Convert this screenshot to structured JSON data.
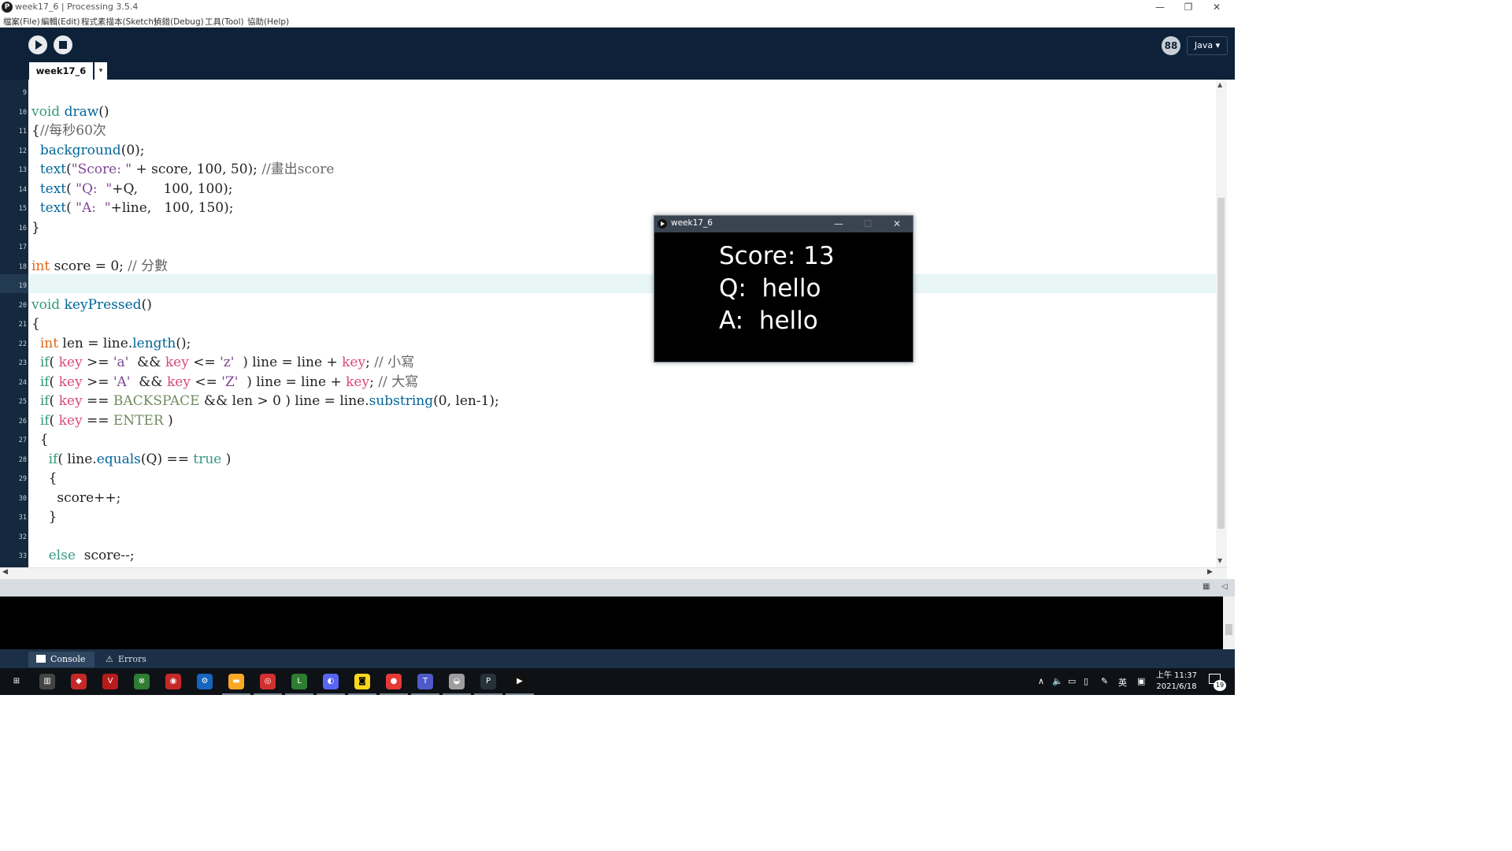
{
  "window": {
    "title": "week17_6 | Processing 3.5.4",
    "app_logo": "P"
  },
  "menu": [
    "檔案(File)",
    "編輯(Edit)",
    "程式素描本(Sketch)",
    "偵錯(Debug)",
    "工具(Tool)",
    "協助(Help)"
  ],
  "toolbar": {
    "mode_label": "Java ▾",
    "mode_icon_glyph": "88",
    "tab_label": "week17_6",
    "tab_menu": "▾"
  },
  "editor": {
    "current_line": 19,
    "lines": [
      {
        "n": "9",
        "tokens": []
      },
      {
        "n": "10",
        "tokens": [
          {
            "t": "void",
            "c": "v"
          },
          {
            "t": " "
          },
          {
            "t": "draw",
            "c": "f"
          },
          {
            "t": "()"
          }
        ]
      },
      {
        "n": "11",
        "tokens": [
          {
            "t": "{"
          },
          {
            "t": "//每秒60次",
            "c": "c"
          }
        ]
      },
      {
        "n": "12",
        "tokens": [
          {
            "t": "  "
          },
          {
            "t": "background",
            "c": "f"
          },
          {
            "t": "(0);"
          }
        ]
      },
      {
        "n": "13",
        "tokens": [
          {
            "t": "  "
          },
          {
            "t": "text",
            "c": "f"
          },
          {
            "t": "("
          },
          {
            "t": "\"Score: \"",
            "c": "s"
          },
          {
            "t": " + score, 100, 50); "
          },
          {
            "t": "//畫出score",
            "c": "c"
          }
        ]
      },
      {
        "n": "14",
        "tokens": [
          {
            "t": "  "
          },
          {
            "t": "text",
            "c": "f"
          },
          {
            "t": "( "
          },
          {
            "t": "\"Q:  \"",
            "c": "s"
          },
          {
            "t": "+Q,      100, 100);"
          }
        ]
      },
      {
        "n": "15",
        "tokens": [
          {
            "t": "  "
          },
          {
            "t": "text",
            "c": "f"
          },
          {
            "t": "( "
          },
          {
            "t": "\"A:  \"",
            "c": "s"
          },
          {
            "t": "+line,   100, 150);"
          }
        ]
      },
      {
        "n": "16",
        "tokens": [
          {
            "t": "}"
          }
        ]
      },
      {
        "n": "17",
        "tokens": []
      },
      {
        "n": "18",
        "tokens": [
          {
            "t": "int",
            "c": "k"
          },
          {
            "t": " score = 0; "
          },
          {
            "t": "// 分數",
            "c": "c"
          }
        ]
      },
      {
        "n": "19",
        "tokens": []
      },
      {
        "n": "20",
        "tokens": [
          {
            "t": "void",
            "c": "v"
          },
          {
            "t": " "
          },
          {
            "t": "keyPressed",
            "c": "f"
          },
          {
            "t": "()"
          }
        ]
      },
      {
        "n": "21",
        "tokens": [
          {
            "t": "{"
          }
        ]
      },
      {
        "n": "22",
        "tokens": [
          {
            "t": "  "
          },
          {
            "t": "int",
            "c": "k"
          },
          {
            "t": " len = line."
          },
          {
            "t": "length",
            "c": "f"
          },
          {
            "t": "();"
          }
        ]
      },
      {
        "n": "23",
        "tokens": [
          {
            "t": "  "
          },
          {
            "t": "if",
            "c": "v"
          },
          {
            "t": "( "
          },
          {
            "t": "key",
            "c": "p"
          },
          {
            "t": " >= "
          },
          {
            "t": "'a'",
            "c": "s"
          },
          {
            "t": "  && "
          },
          {
            "t": "key",
            "c": "p"
          },
          {
            "t": " <= "
          },
          {
            "t": "'z'",
            "c": "s"
          },
          {
            "t": "  ) line = line + "
          },
          {
            "t": "key",
            "c": "p"
          },
          {
            "t": "; "
          },
          {
            "t": "// 小寫",
            "c": "c"
          }
        ]
      },
      {
        "n": "24",
        "tokens": [
          {
            "t": "  "
          },
          {
            "t": "if",
            "c": "v"
          },
          {
            "t": "( "
          },
          {
            "t": "key",
            "c": "p"
          },
          {
            "t": " >= "
          },
          {
            "t": "'A'",
            "c": "s"
          },
          {
            "t": "  && "
          },
          {
            "t": "key",
            "c": "p"
          },
          {
            "t": " <= "
          },
          {
            "t": "'Z'",
            "c": "s"
          },
          {
            "t": "  ) line = line + "
          },
          {
            "t": "key",
            "c": "p"
          },
          {
            "t": "; "
          },
          {
            "t": "// 大寫",
            "c": "c"
          }
        ]
      },
      {
        "n": "25",
        "tokens": [
          {
            "t": "  "
          },
          {
            "t": "if",
            "c": "v"
          },
          {
            "t": "( "
          },
          {
            "t": "key",
            "c": "p"
          },
          {
            "t": " == "
          },
          {
            "t": "BACKSPACE",
            "c": "g"
          },
          {
            "t": " && len > 0 ) line = line."
          },
          {
            "t": "substring",
            "c": "f"
          },
          {
            "t": "(0, len-1);"
          }
        ]
      },
      {
        "n": "26",
        "tokens": [
          {
            "t": "  "
          },
          {
            "t": "if",
            "c": "v"
          },
          {
            "t": "( "
          },
          {
            "t": "key",
            "c": "p"
          },
          {
            "t": " == "
          },
          {
            "t": "ENTER",
            "c": "g"
          },
          {
            "t": " )"
          }
        ]
      },
      {
        "n": "27",
        "tokens": [
          {
            "t": "  {"
          }
        ]
      },
      {
        "n": "28",
        "tokens": [
          {
            "t": "    "
          },
          {
            "t": "if",
            "c": "v"
          },
          {
            "t": "( line."
          },
          {
            "t": "equals",
            "c": "f"
          },
          {
            "t": "(Q) == "
          },
          {
            "t": "true",
            "c": "v"
          },
          {
            "t": " )"
          }
        ]
      },
      {
        "n": "29",
        "tokens": [
          {
            "t": "    {"
          }
        ]
      },
      {
        "n": "30",
        "tokens": [
          {
            "t": "      score++;"
          }
        ]
      },
      {
        "n": "31",
        "tokens": [
          {
            "t": "    }"
          }
        ]
      },
      {
        "n": "32",
        "tokens": []
      },
      {
        "n": "33",
        "tokens": [
          {
            "t": "    "
          },
          {
            "t": "else",
            "c": "v"
          },
          {
            "t": "  score--;"
          }
        ]
      }
    ]
  },
  "bottom_tabs": {
    "console": "Console",
    "errors": "Errors"
  },
  "sketch_window": {
    "title": "week17_6",
    "output_lines": [
      "Score: 13",
      "Q:  hello",
      "A:  hello"
    ]
  },
  "taskbar": {
    "time": "上午 11:37",
    "date": "2021/6/18",
    "ime": "英",
    "notifications": "19",
    "icons": [
      "start-icon",
      "task-view-icon",
      "armoury-icon",
      "valorant-icon",
      "xbox-icon",
      "steelseries-icon",
      "steam-icon",
      "file-explorer-icon",
      "netease-music-icon",
      "line-icon",
      "discord-icon",
      "kakao-icon",
      "chrome-icon",
      "teams-icon",
      "vpn-icon",
      "processing-icon",
      "processing-sketch-icon"
    ]
  },
  "colors": {
    "toolbar_bg": "#0d2238",
    "gutter_bg": "#14293e",
    "current_line_bg": "#e9f6f6",
    "console_bg": "#000000",
    "taskbar_bg": "#0e1217"
  }
}
